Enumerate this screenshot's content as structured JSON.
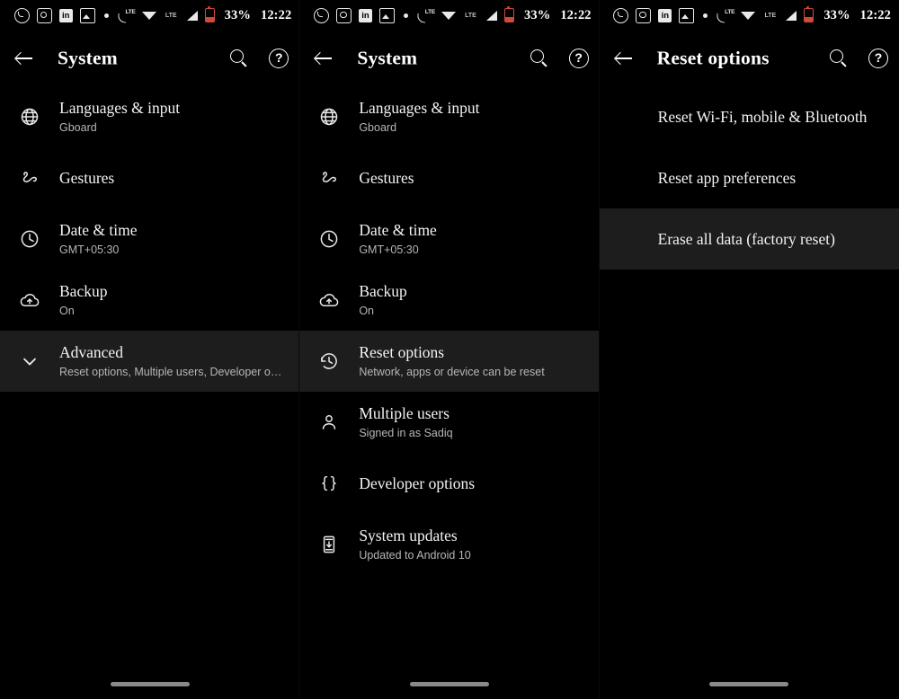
{
  "status_bar": {
    "icons": [
      "whatsapp-icon",
      "messages-icon",
      "linkedin-icon",
      "gallery-icon",
      "more-dot-icon",
      "volte-icon",
      "wifi-icon",
      "lte-label-icon",
      "signal-icon",
      "battery-icon"
    ],
    "lte_label": "LTE",
    "battery_percent": "33%",
    "clock": "12:22"
  },
  "panels": [
    {
      "id": "panel-system-collapsed",
      "appbar": {
        "back_icon": "back-arrow-icon",
        "title": "System",
        "search_icon": "search-icon",
        "help_icon": "help-icon"
      },
      "rows": [
        {
          "icon": "language-globe-icon",
          "title": "Languages & input",
          "subtitle": "Gboard",
          "selected": false
        },
        {
          "icon": "gestures-icon",
          "title": "Gestures",
          "subtitle": "",
          "selected": false
        },
        {
          "icon": "clock-icon",
          "title": "Date & time",
          "subtitle": "GMT+05:30",
          "selected": false
        },
        {
          "icon": "cloud-backup-icon",
          "title": "Backup",
          "subtitle": "On",
          "selected": false
        },
        {
          "icon": "chevron-down-icon",
          "title": "Advanced",
          "subtitle": "Reset options, Multiple users, Developer opti..",
          "selected": true
        }
      ]
    },
    {
      "id": "panel-system-expanded",
      "appbar": {
        "back_icon": "back-arrow-icon",
        "title": "System",
        "search_icon": "search-icon",
        "help_icon": "help-icon"
      },
      "rows": [
        {
          "icon": "language-globe-icon",
          "title": "Languages & input",
          "subtitle": "Gboard",
          "selected": false
        },
        {
          "icon": "gestures-icon",
          "title": "Gestures",
          "subtitle": "",
          "selected": false
        },
        {
          "icon": "clock-icon",
          "title": "Date & time",
          "subtitle": "GMT+05:30",
          "selected": false
        },
        {
          "icon": "cloud-backup-icon",
          "title": "Backup",
          "subtitle": "On",
          "selected": false
        },
        {
          "icon": "history-restore-icon",
          "title": "Reset options",
          "subtitle": "Network, apps or device can be reset",
          "selected": true
        },
        {
          "icon": "person-icon",
          "title": "Multiple users",
          "subtitle": "Signed in as Sadiq",
          "selected": false
        },
        {
          "icon": "braces-icon",
          "title": "Developer options",
          "subtitle": "",
          "selected": false
        },
        {
          "icon": "phone-update-icon",
          "title": "System updates",
          "subtitle": "Updated to Android 10",
          "selected": false
        }
      ]
    },
    {
      "id": "panel-reset-options",
      "appbar": {
        "back_icon": "back-arrow-icon",
        "title": "Reset options",
        "search_icon": "search-icon",
        "help_icon": "help-icon"
      },
      "rows": [
        {
          "icon": "",
          "title": "Reset Wi-Fi, mobile & Bluetooth",
          "subtitle": "",
          "selected": false
        },
        {
          "icon": "",
          "title": "Reset app preferences",
          "subtitle": "",
          "selected": false
        },
        {
          "icon": "",
          "title": "Erase all data (factory reset)",
          "subtitle": "",
          "selected": true
        }
      ]
    }
  ],
  "home_indicator": {
    "name": "home-gesture-pill"
  },
  "colors": {
    "background": "#000000",
    "selected_row": "#1d1d1d",
    "primary_text": "#f3f3f3",
    "secondary_text": "#b6b6b6",
    "battery_low": "#d04a3a",
    "home_pill": "#8a8a8a"
  }
}
